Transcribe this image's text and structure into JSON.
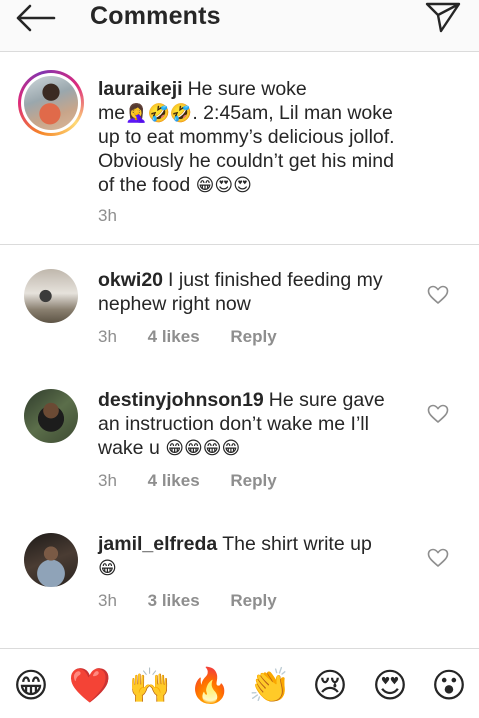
{
  "header": {
    "title": "Comments",
    "back_icon": "arrow-left-icon",
    "share_icon": "paper-plane-icon"
  },
  "caption": {
    "username": "lauraikeji",
    "text_line1": "He sure woke",
    "text_line2_prefix": "me",
    "text_line2_emoji": "🤦‍♀️🤣🤣",
    "text_line2_rest": ". 2:45am, Lil man woke",
    "text_line3": "up to eat mommy’s delicious jollof.",
    "text_line4": "Obviously he couldn’t get his mind",
    "text_line5": "of the food",
    "text_line5_emoji": "😁😍😍",
    "time": "3h"
  },
  "comments": [
    {
      "username": "okwi20",
      "text_line1": "I just finished feeding my",
      "text_line2": "nephew right now",
      "time": "3h",
      "likes": "4 likes",
      "reply": "Reply"
    },
    {
      "username": "destinyjohnson19",
      "text_line1": "He sure gave",
      "text_line2": "an instruction don’t wake me I’ll",
      "text_line3": "wake u",
      "text_line3_emoji": "😁😁😁😁",
      "time": "3h",
      "likes": "4 likes",
      "reply": "Reply"
    },
    {
      "username": "jamil_elfreda",
      "text_line1": "The shirt write up",
      "text_line2_emoji": "😁",
      "time": "3h",
      "likes": "3 likes",
      "reply": "Reply"
    }
  ],
  "emoji_bar": [
    {
      "glyph": "😁",
      "name": "grinning-emoji"
    },
    {
      "glyph": "❤️",
      "name": "heart-emoji"
    },
    {
      "glyph": "🙌",
      "name": "raised-hands-emoji"
    },
    {
      "glyph": "🔥",
      "name": "fire-emoji"
    },
    {
      "glyph": "👏",
      "name": "clapping-emoji"
    },
    {
      "glyph": "😢",
      "name": "sad-emoji"
    },
    {
      "glyph": "😍",
      "name": "heart-eyes-emoji"
    },
    {
      "glyph": "😮",
      "name": "surprised-emoji"
    }
  ],
  "colors": {
    "text": "#262626",
    "muted": "#8e8e8e",
    "divider": "#dbdbdb",
    "header_bg": "#fafafa"
  }
}
